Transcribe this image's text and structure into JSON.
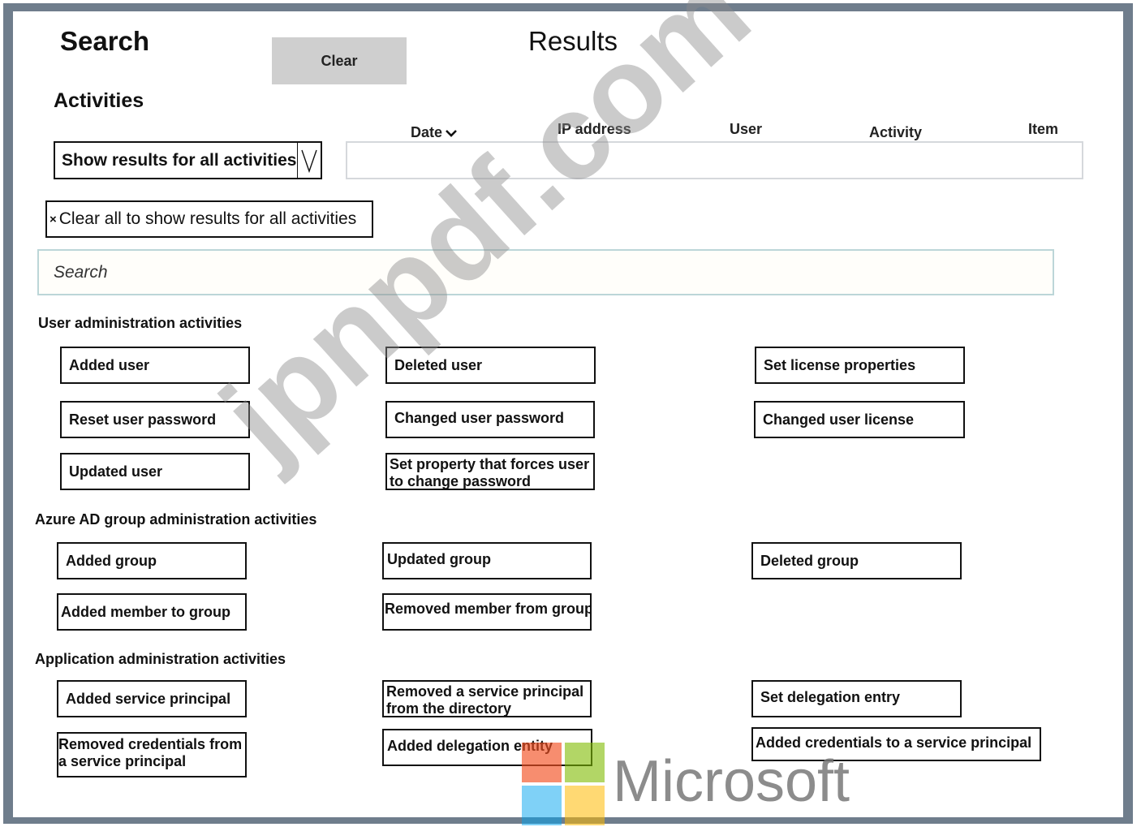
{
  "header": {
    "search_title": "Search",
    "clear_label": "Clear",
    "results_title": "Results",
    "activities_title": "Activities"
  },
  "results": {
    "columns": [
      "Date",
      "IP address",
      "User",
      "Activity",
      "Item"
    ]
  },
  "filter": {
    "dropdown_value": "Show results for all activities",
    "chip_label": "Clear all to show results for all activities",
    "search_placeholder": "Search"
  },
  "sections": [
    {
      "title": "User administration activities",
      "items": [
        "Added user",
        "Deleted user",
        "Set license properties",
        "Reset user password",
        "Changed user password",
        "Changed user license",
        "Updated user",
        "Set property that forces user\nto change password"
      ]
    },
    {
      "title": "Azure AD group administration activities",
      "items": [
        "Added group",
        "Updated group",
        "Deleted group",
        "Added member to group",
        "Removed member from group"
      ]
    },
    {
      "title": "Application administration activities",
      "items": [
        "Added service principal",
        "Removed a service principal\nfrom the directory",
        "Set delegation entry",
        "Removed credentials from\na service principal",
        "Added delegation entity",
        "Added credentials to a service principal"
      ]
    }
  ],
  "watermark": {
    "text": "jpnpdf.com",
    "brand": "Microsoft",
    "logo_colors": [
      "#f25022",
      "#7fba00",
      "#00a4ef",
      "#ffb900"
    ]
  }
}
